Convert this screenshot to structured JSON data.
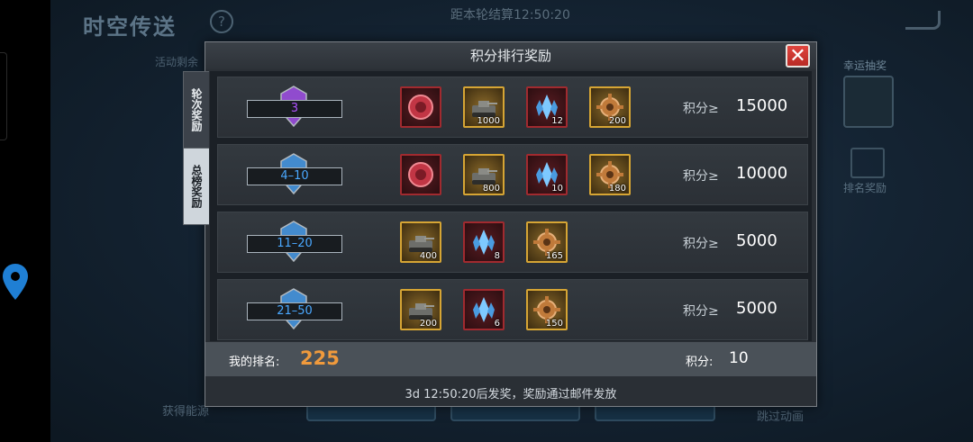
{
  "background": {
    "title": "时空传送",
    "timer": "距本轮结算12:50:20",
    "side_label": "活动剩余",
    "luck_label": "幸运抽奖",
    "rank_reward_label": "排名奖励",
    "get_power_label": "获得能源",
    "skip_label": "跳过动画"
  },
  "dialog": {
    "title": "积分排行奖励",
    "tabs": [
      {
        "label": "轮次奖励",
        "active": false
      },
      {
        "label": "总榜奖励",
        "active": true
      }
    ],
    "score_prefix": "积分≥",
    "rows": [
      {
        "rank": "3",
        "rank_color": "#b052ff",
        "badge": "purple-rank-badge",
        "items": [
          {
            "icon": "red-lion-emblem-icon",
            "count": "",
            "frame": "red"
          },
          {
            "icon": "tank-ur-icon",
            "count": "1000",
            "frame": "gold"
          },
          {
            "icon": "blue-crystal-icon",
            "count": "12",
            "frame": "red"
          },
          {
            "icon": "gear-part-icon",
            "count": "200",
            "frame": "gold"
          }
        ],
        "score": "15000"
      },
      {
        "rank": "4–10",
        "rank_color": "#4aa8ff",
        "badge": "blue-rank-badge",
        "items": [
          {
            "icon": "red-lion-emblem-icon",
            "count": "",
            "frame": "red"
          },
          {
            "icon": "tank-ur-icon",
            "count": "800",
            "frame": "gold"
          },
          {
            "icon": "blue-crystal-icon",
            "count": "10",
            "frame": "red"
          },
          {
            "icon": "gear-part-icon",
            "count": "180",
            "frame": "gold"
          }
        ],
        "score": "10000"
      },
      {
        "rank": "11–20",
        "rank_color": "#4aa8ff",
        "badge": "blue-rank-badge",
        "items": [
          {
            "icon": "tank-ur-icon",
            "count": "400",
            "frame": "gold"
          },
          {
            "icon": "blue-crystal-icon",
            "count": "8",
            "frame": "red"
          },
          {
            "icon": "gear-part-icon",
            "count": "165",
            "frame": "gold"
          }
        ],
        "score": "5000"
      },
      {
        "rank": "21–50",
        "rank_color": "#4aa8ff",
        "badge": "blue-rank-badge",
        "items": [
          {
            "icon": "tank-ur-icon",
            "count": "200",
            "frame": "gold"
          },
          {
            "icon": "blue-crystal-icon",
            "count": "6",
            "frame": "red"
          },
          {
            "icon": "gear-part-icon",
            "count": "150",
            "frame": "gold"
          }
        ],
        "score": "5000"
      }
    ],
    "my_rank_label": "我的排名:",
    "my_rank_value": "225",
    "my_points_label": "积分:",
    "my_points_value": "10",
    "footer": "3d 12:50:20后发奖，奖励通过邮件发放"
  }
}
